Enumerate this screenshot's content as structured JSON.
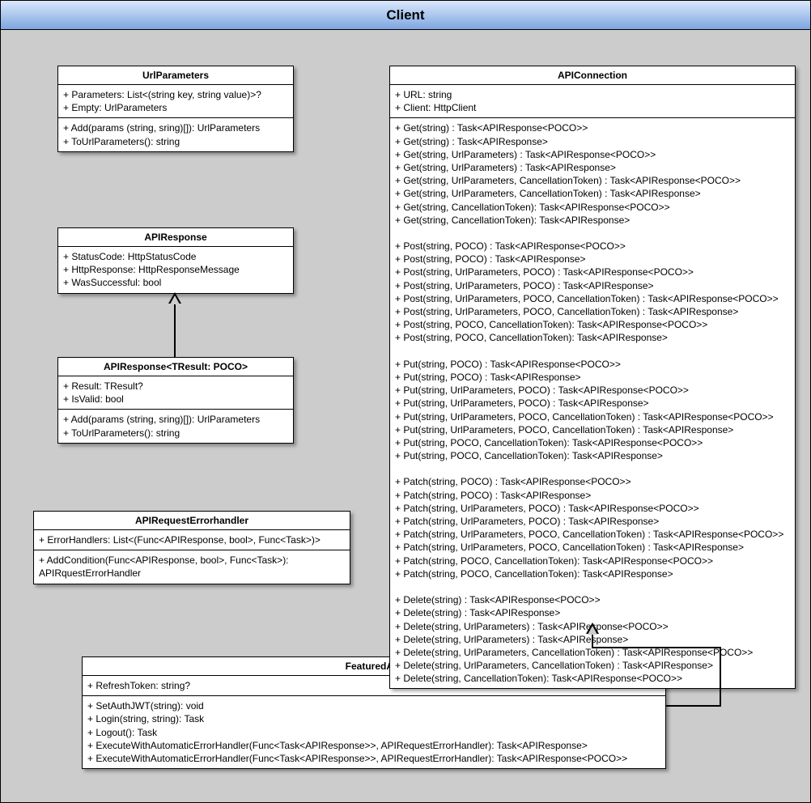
{
  "package": {
    "title": "Client"
  },
  "classes": {
    "urlParameters": {
      "title": "UrlParameters",
      "attrs": "+ Parameters: List<(string key, string value)>?\n+ Empty: UrlParameters",
      "ops": "+ Add(params (string, sring)[]): UrlParameters\n+ ToUrlParameters(): string"
    },
    "apiResponse": {
      "title": "APIResponse",
      "attrs": "+ StatusCode: HttpStatusCode\n+ HttpResponse: HttpResponseMessage\n+ WasSuccessful: bool"
    },
    "apiResponseT": {
      "title": "APIResponse<TResult: POCO>",
      "attrs": "+ Result: TResult?\n+ IsValid: bool",
      "ops": "+ Add(params (string, sring)[]): UrlParameters\n+ ToUrlParameters(): string"
    },
    "errorHandler": {
      "title": "APIRequestErrorhandler",
      "attrs": "+ ErrorHandlers: List<(Func<APIResponse, bool>, Func<Task>)>",
      "ops": "+ AddCondition(Func<APIResponse, bool>, Func<Task>): APIRquestErrorHandler"
    },
    "featuredApi": {
      "title": "FeaturedAPI",
      "attrs": "+ RefreshToken: string?",
      "ops": "+ SetAuthJWT(string): void\n+ Login(string, string): Task\n+ Logout(): Task\n+ ExecuteWithAutomaticErrorHandler(Func<Task<APIResponse>>, APIRequestErrorHandler): Task<APIResponse>\n+ ExecuteWithAutomaticErrorHandler(Func<Task<APIResponse>>, APIRequestErrorHandler): Task<APIResponse<POCO>>"
    },
    "apiConnection": {
      "title": "APIConnection",
      "attrs": "+ URL: string\n+ Client: HttpClient",
      "ops": "+ Get(string) : Task<APIResponse<POCO>>\n+ Get(string) : Task<APIResponse>\n+ Get(string, UrlParameters) : Task<APIResponse<POCO>>\n+ Get(string, UrlParameters) : Task<APIResponse>\n+ Get(string, UrlParameters, CancellationToken) : Task<APIResponse<POCO>>\n+ Get(string, UrlParameters, CancellationToken) : Task<APIResponse>\n+ Get(string, CancellationToken): Task<APIResponse<POCO>>\n+ Get(string, CancellationToken): Task<APIResponse>\n\n+ Post(string, POCO) : Task<APIResponse<POCO>>\n+ Post(string, POCO) : Task<APIResponse>\n+ Post(string, UrlParameters, POCO) : Task<APIResponse<POCO>>\n+ Post(string, UrlParameters, POCO) : Task<APIResponse>\n+ Post(string, UrlParameters, POCO, CancellationToken) : Task<APIResponse<POCO>>\n+ Post(string, UrlParameters, POCO, CancellationToken) : Task<APIResponse>\n+ Post(string, POCO, CancellationToken): Task<APIResponse<POCO>>\n+ Post(string, POCO, CancellationToken): Task<APIResponse>\n\n+ Put(string, POCO) : Task<APIResponse<POCO>>\n+ Put(string, POCO) : Task<APIResponse>\n+ Put(string, UrlParameters, POCO) : Task<APIResponse<POCO>>\n+ Put(string, UrlParameters, POCO) : Task<APIResponse>\n+ Put(string, UrlParameters, POCO, CancellationToken) : Task<APIResponse<POCO>>\n+ Put(string, UrlParameters, POCO, CancellationToken) : Task<APIResponse>\n+ Put(string, POCO, CancellationToken): Task<APIResponse<POCO>>\n+ Put(string, POCO, CancellationToken): Task<APIResponse>\n\n+ Patch(string, POCO) : Task<APIResponse<POCO>>\n+ Patch(string, POCO) : Task<APIResponse>\n+ Patch(string, UrlParameters, POCO) : Task<APIResponse<POCO>>\n+ Patch(string, UrlParameters, POCO) : Task<APIResponse>\n+ Patch(string, UrlParameters, POCO, CancellationToken) : Task<APIResponse<POCO>>\n+ Patch(string, UrlParameters, POCO, CancellationToken) : Task<APIResponse>\n+ Patch(string, POCO, CancellationToken): Task<APIResponse<POCO>>\n+ Patch(string, POCO, CancellationToken): Task<APIResponse>\n\n+ Delete(string) : Task<APIResponse<POCO>>\n+ Delete(string) : Task<APIResponse>\n+ Delete(string, UrlParameters) : Task<APIResponse<POCO>>\n+ Delete(string, UrlParameters) : Task<APIResponse>\n+ Delete(string, UrlParameters, CancellationToken) : Task<APIResponse<POCO>>\n+ Delete(string, UrlParameters, CancellationToken) : Task<APIResponse>\n+ Delete(string, CancellationToken): Task<APIResponse<POCO>>"
    }
  }
}
